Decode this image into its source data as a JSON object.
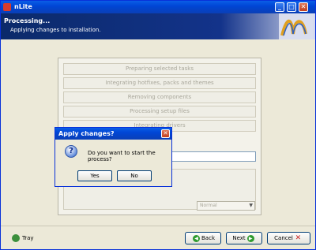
{
  "window": {
    "title": "nLite"
  },
  "titlebar_buttons": {
    "minimize": "_",
    "maximize": "□",
    "close": "✕"
  },
  "header": {
    "title": "Processing...",
    "subtitle": "Applying changes to installation."
  },
  "tasks": [
    "Preparing selected tasks",
    "Integrating hotfixes, packs and themes",
    "Removing components",
    "Processing setup files",
    "Integrating drivers"
  ],
  "combo": {
    "value": "Normal"
  },
  "dialog": {
    "title": "Apply changes?",
    "icon": "question-icon",
    "message": "Do you want to start the process?",
    "yes_label": "Yes",
    "no_label": "No",
    "close": "✕"
  },
  "footer": {
    "tray_label": "Tray",
    "back_label": "Back",
    "next_label": "Next",
    "cancel_label": "Cancel"
  },
  "colors": {
    "titlebar": "#0a5fe6",
    "header": "#0b2a6a",
    "face": "#ece9d8"
  }
}
